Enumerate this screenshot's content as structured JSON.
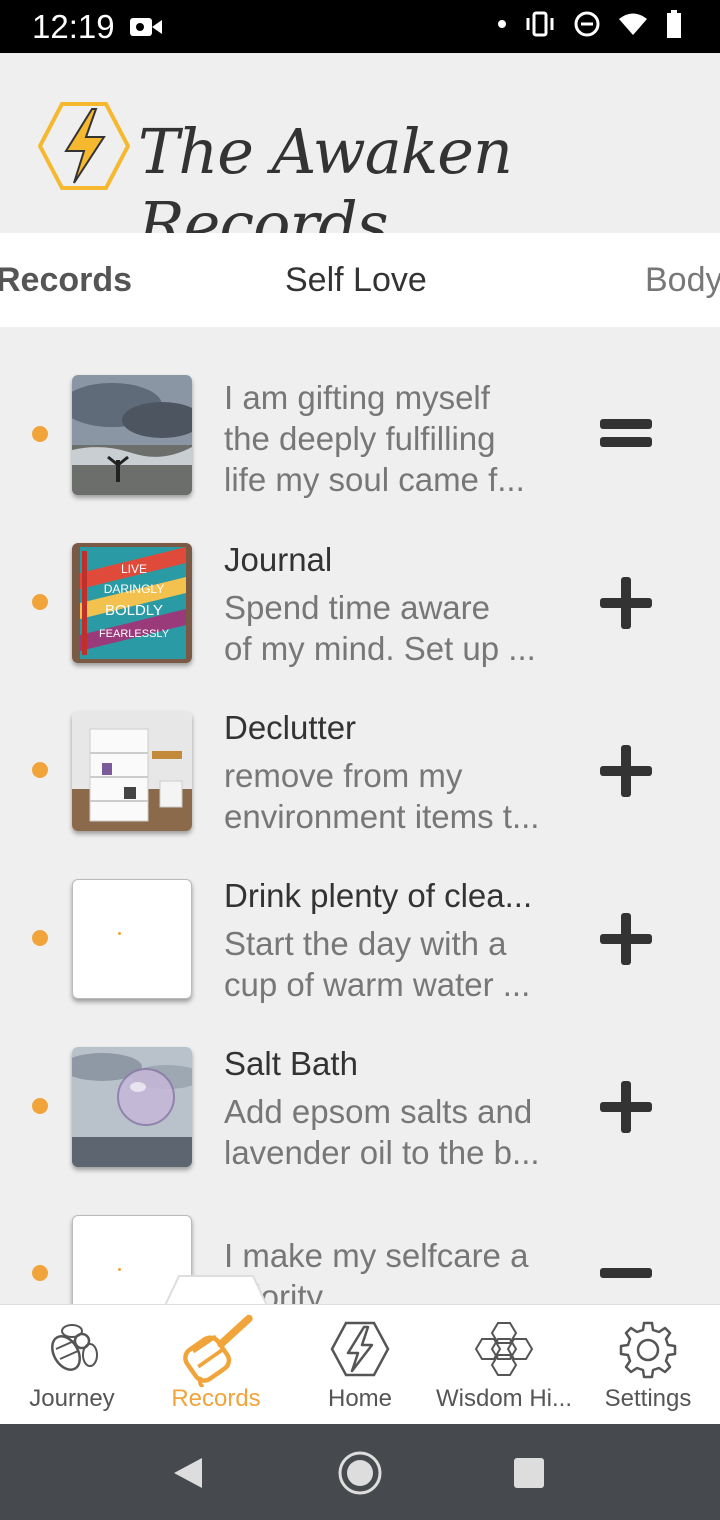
{
  "status": {
    "time": "12:19"
  },
  "app": {
    "title": "The Awaken Records"
  },
  "tabs": [
    {
      "label": "Records"
    },
    {
      "label": "Self Love"
    },
    {
      "label": "Body"
    }
  ],
  "items": [
    {
      "title": "",
      "line1": "I am gifting myself",
      "line2": "the deeply fulfilling",
      "line3": "life my soul came f...",
      "action": "equals"
    },
    {
      "title": "Journal",
      "line1": "Spend time aware",
      "line2": "of my mind. Set up ...",
      "action": "plus"
    },
    {
      "title": "Declutter",
      "line1": "remove from my",
      "line2": "environment items t...",
      "action": "plus"
    },
    {
      "title": "Drink plenty of clea...",
      "line1": "Start the day with a",
      "line2": "cup of warm water ...",
      "action": "plus"
    },
    {
      "title": "Salt Bath",
      "line1": "Add epsom salts and",
      "line2": "lavender oil to the b...",
      "action": "plus"
    },
    {
      "title": "",
      "line1": "I make my selfcare a",
      "line2": "priority",
      "action": "minus"
    }
  ],
  "nav": [
    {
      "label": "Journey",
      "icon": "bee-icon"
    },
    {
      "label": "Records",
      "icon": "honey-dipper-icon"
    },
    {
      "label": "Home",
      "icon": "lightning-hex-icon"
    },
    {
      "label": "Wisdom Hi...",
      "icon": "honeycomb-icon"
    },
    {
      "label": "Settings",
      "icon": "gear-icon"
    }
  ],
  "colors": {
    "accent": "#f0a43a",
    "text": "#333333",
    "muted": "#777777"
  }
}
